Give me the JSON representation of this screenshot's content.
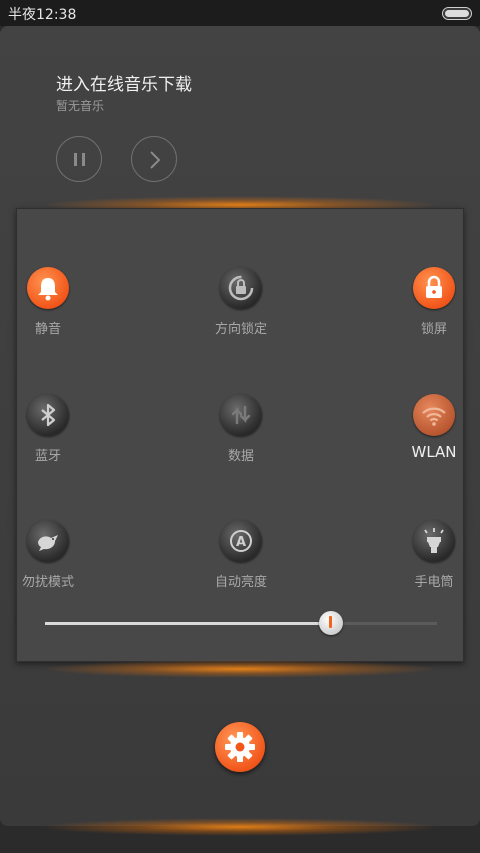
{
  "status_bar": {
    "time": "半夜12:38",
    "battery_icon": "battery-icon"
  },
  "music": {
    "title": "进入在线音乐下载",
    "subtitle": "暂无音乐",
    "controls": [
      {
        "name": "pause-button",
        "icon": "pause-icon"
      },
      {
        "name": "next-button",
        "icon": "chevron-right-icon"
      }
    ]
  },
  "toggles": [
    {
      "label": "静音",
      "icon": "bell-icon",
      "state": "on"
    },
    {
      "label": "方向锁定",
      "icon": "rotation-lock-icon",
      "state": "off"
    },
    {
      "label": "锁屏",
      "icon": "lock-icon",
      "state": "on"
    },
    {
      "label": "蓝牙",
      "icon": "bluetooth-icon",
      "state": "off"
    },
    {
      "label": "数据",
      "icon": "data-sync-icon",
      "state": "off"
    },
    {
      "label": "WLAN",
      "icon": "wifi-icon",
      "state": "on"
    },
    {
      "label": "勿扰模式",
      "icon": "bird-icon",
      "state": "off"
    },
    {
      "label": "自动亮度",
      "icon": "auto-brightness-icon",
      "state": "off"
    },
    {
      "label": "手电筒",
      "icon": "flashlight-icon",
      "state": "off"
    }
  ],
  "brightness": {
    "value": 0.73
  },
  "settings": {
    "icon": "gear-icon"
  },
  "colors": {
    "accent": "#f2561a",
    "glow": "#ff8c14",
    "panel": "#484848"
  }
}
